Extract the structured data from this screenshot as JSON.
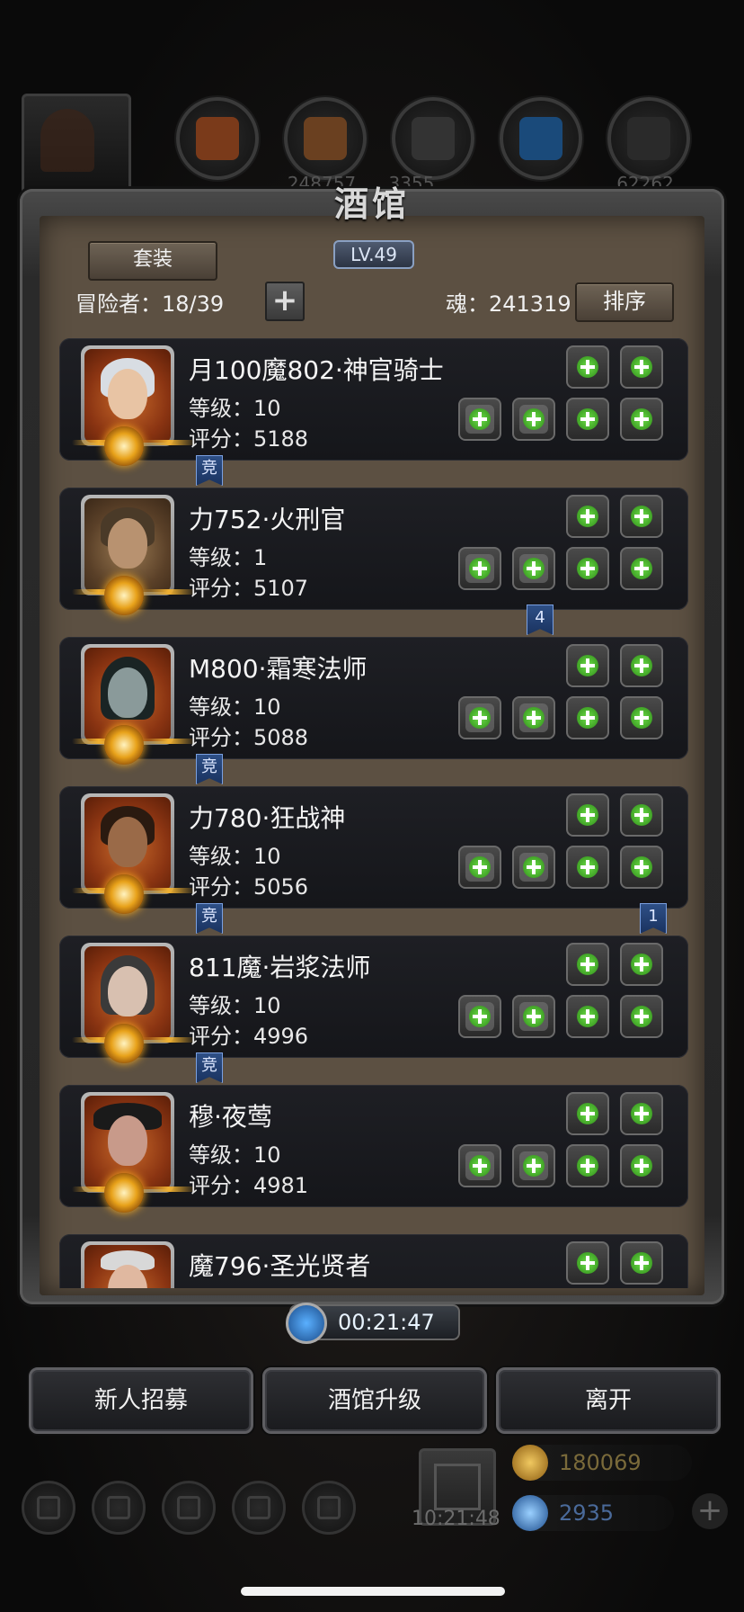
{
  "screen_title": "酒馆",
  "level_badge": "LV.49",
  "set_button": "套装",
  "adventurers_label": "冒险者：18/39",
  "soul_label": "魂：241319",
  "sort_button": "排序",
  "top_resources": [
    "248757",
    "3355",
    "62262"
  ],
  "adventurers": [
    {
      "name": "月100魔802·神官骑士",
      "level": "等级：10",
      "score": "评分：5188",
      "tag": "竞",
      "portrait_color": "#b9c4d0"
    },
    {
      "name": "力752·火刑官",
      "level": "等级：1",
      "score": "评分：5107",
      "tag": "4",
      "portrait_color": "#7a5a3a"
    },
    {
      "name": "M800·霜寒法师",
      "level": "等级：10",
      "score": "评分：5088",
      "tag": "竞",
      "portrait_color": "#2a3a3a"
    },
    {
      "name": "力780·狂战神",
      "level": "等级：10",
      "score": "评分：5056",
      "tag": "竞",
      "tag2": "1",
      "portrait_color": "#4a2a1a"
    },
    {
      "name": "811魔·岩浆法师",
      "level": "等级：10",
      "score": "评分：4996",
      "tag": "竞",
      "portrait_color": "#3a3a3a"
    },
    {
      "name": "穆·夜莺",
      "level": "等级：10",
      "score": "评分：4981",
      "portrait_color": "#1a1a1a"
    },
    {
      "name": "魔796·圣光贤者",
      "level": "",
      "score": "",
      "portrait_color": "#c0c0c0"
    }
  ],
  "timer": "00:21:47",
  "buttons": {
    "recruit": "新人招募",
    "upgrade": "酒馆升级",
    "leave": "离开"
  },
  "gift_timer": "10:21:48",
  "gold": "180069",
  "gems": "2935",
  "plus_sign": "+",
  "colors": {
    "accent_green": "#55d040",
    "tag_blue": "#2e4f86",
    "frame": "#5c5042"
  }
}
